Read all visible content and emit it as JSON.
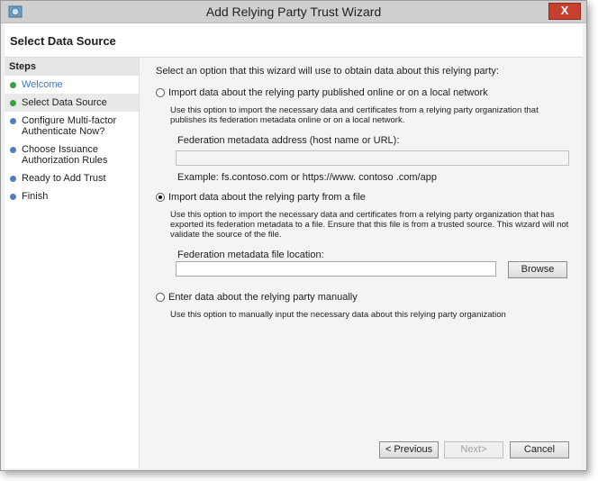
{
  "window": {
    "title": "Add Relying Party Trust Wizard",
    "close_glyph": "X"
  },
  "header": {
    "title": "Select Data Source"
  },
  "sidebar": {
    "heading": "Steps",
    "steps": [
      {
        "label": "Welcome"
      },
      {
        "label": "Select Data Source"
      },
      {
        "label": "Configure Multi-factor Authenticate Now?"
      },
      {
        "label": "Choose Issuance Authorization Rules"
      },
      {
        "label": "Ready to Add Trust"
      },
      {
        "label": "Finish"
      }
    ]
  },
  "main": {
    "prompt": "Select an option that this wizard will use to obtain data about this relying party:",
    "option_online": {
      "label": "Import data about the relying party published online or on a local network",
      "description": "Use this option to import the necessary data and certificates from a relying party organization that publishes its federation metadata online or on a local network.",
      "field_label": "Federation metadata address (host name or URL):",
      "field_value": "",
      "example": "Example: fs.contoso.com or https://www. contoso .com/app",
      "selected": false
    },
    "option_file": {
      "label": "Import data about the relying party from a file",
      "description": "Use this option to import the necessary data and certificates from a relying party organization that has exported its federation metadata to a file. Ensure that this file is from a trusted source. This wizard will not validate the source of the file.",
      "field_label": "Federation metadata file location:",
      "field_value": "",
      "browse_label": "Browse",
      "selected": true
    },
    "option_manual": {
      "label": "Enter data about the relying party manually",
      "description": "Use this option to manually input the necessary data about this relying party organization",
      "selected": false
    }
  },
  "footer": {
    "previous_label": "< Previous",
    "next_label": "Next>",
    "cancel_label": "Cancel"
  }
}
